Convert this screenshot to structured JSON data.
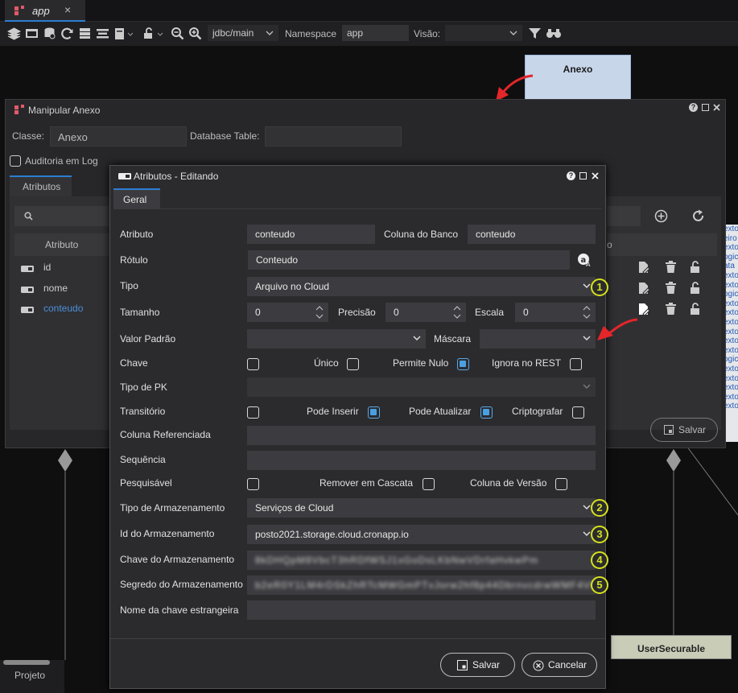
{
  "tab": {
    "label": "app",
    "close": "×"
  },
  "toolbar": {
    "datasource": "jdbc/main",
    "namespace_label": "Namespace",
    "namespace_value": "app",
    "view_label": "Visão:",
    "view_value": ""
  },
  "diagram": {
    "anexo_entity": "Anexo",
    "user_entity": "UserSecurable",
    "right_strip_lines": [
      "exto",
      "eiro",
      "exto",
      "ogic",
      "ata",
      "exto",
      "exto",
      "ogic",
      "exto",
      "exto",
      "exto",
      "exto",
      "exto",
      "exto",
      "ogic",
      "exto",
      "exto",
      "exto",
      "exto",
      "exto"
    ],
    "project_label": "Projeto"
  },
  "outer_dialog": {
    "title": "Manipular Anexo",
    "class_label": "Classe:",
    "class_value": "Anexo",
    "table_label": "Database Table:",
    "table_value": "",
    "audit_label": "Auditoria em Log",
    "attributes_tab": "Atributos",
    "attr_column": "Atributo",
    "attributes": [
      {
        "name": "id"
      },
      {
        "name": "nome"
      },
      {
        "name": "conteudo"
      }
    ],
    "save_label": "Salvar"
  },
  "inner_dialog": {
    "title": "Atributos - Editando",
    "tab_general": "Geral",
    "fields": {
      "atributo_label": "Atributo",
      "atributo_value": "conteudo",
      "coluna_label": "Coluna do Banco",
      "coluna_value": "conteudo",
      "rotulo_label": "Rótulo",
      "rotulo_value": "Conteudo",
      "tipo_label": "Tipo",
      "tipo_value": "Arquivo no Cloud",
      "tamanho_label": "Tamanho",
      "tamanho_value": "0",
      "precisao_label": "Precisão",
      "precisao_value": "0",
      "escala_label": "Escala",
      "escala_value": "0",
      "valor_padrao_label": "Valor Padrão",
      "valor_padrao_value": "",
      "mascara_label": "Máscara",
      "mascara_value": "",
      "chave_label": "Chave",
      "unico_label": "Único",
      "permite_nulo_label": "Permite Nulo",
      "ignora_rest_label": "Ignora no REST",
      "tipo_pk_label": "Tipo de PK",
      "transitorio_label": "Transitório",
      "pode_inserir_label": "Pode Inserir",
      "pode_atualizar_label": "Pode Atualizar",
      "criptografar_label": "Criptografar",
      "coluna_ref_label": "Coluna Referenciada",
      "sequencia_label": "Sequência",
      "pesquisavel_label": "Pesquisável",
      "remover_cascata_label": "Remover em Cascata",
      "coluna_versao_label": "Coluna de Versão",
      "tipo_armaz_label": "Tipo de Armazenamento",
      "tipo_armaz_value": "Serviços de Cloud",
      "id_armaz_label": "Id do Armazenamento",
      "id_armaz_value": "posto2021.storage.cloud.cronapp.io",
      "chave_armaz_label": "Chave do Armazenamento",
      "chave_armaz_value": "8kDHQpM8VbcT3hRDfWSJ1xGoDsLKbNwVDrfaHvkwPm",
      "segredo_armaz_label": "Segredo do Armazenamento",
      "segredo_armaz_value": "b2eR0Y1LM4rDSkZhRTcMWGmPTvJorw2hf8p44DbrnvcdrwWMF4V0rDJ",
      "fk_name_label": "Nome da chave estrangeira",
      "fk_name_value": ""
    },
    "checkboxes": {
      "chave": false,
      "unico": false,
      "permite_nulo": true,
      "ignora_rest": false,
      "transitorio": false,
      "pode_inserir": true,
      "pode_atualizar": true,
      "criptografar": false,
      "pesquisavel": false,
      "remover_cascata": false,
      "coluna_versao": false
    },
    "badges": [
      "1",
      "2",
      "3",
      "4",
      "5"
    ],
    "save_label": "Salvar",
    "cancel_label": "Cancelar"
  },
  "colors": {
    "accent": "#2d7dd2",
    "badge": "#d5e21c",
    "checkbox_on": "#4a9fe0",
    "arrow": "#e3262a"
  }
}
